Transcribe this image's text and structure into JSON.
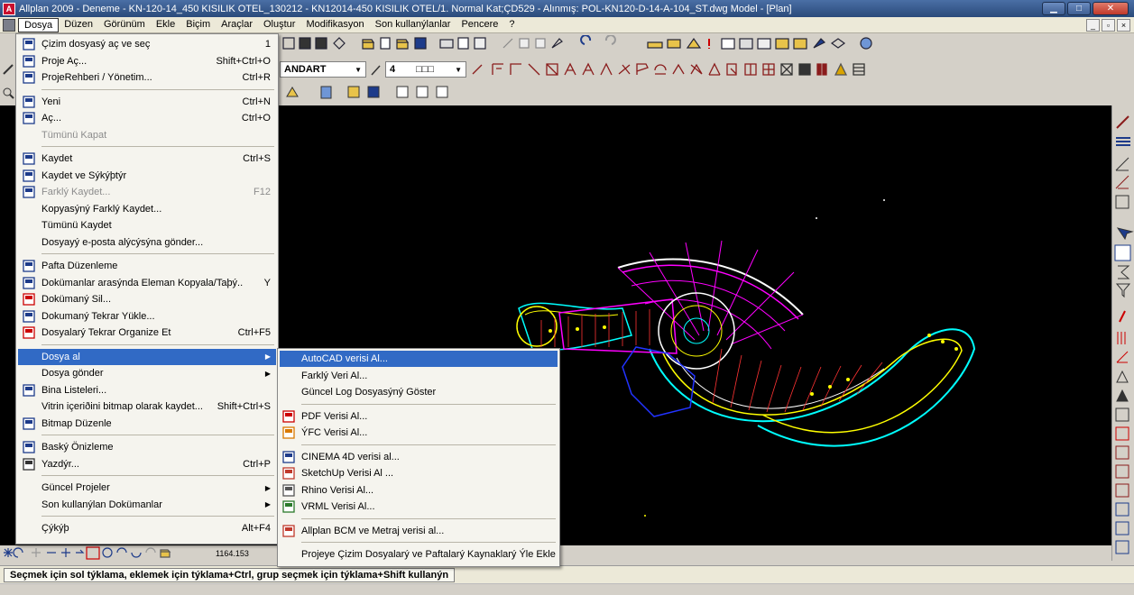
{
  "window": {
    "title": "Allplan 2009 - Deneme - KN-120-14_450 KISILIK OTEL_130212 - KN12014-450 KISILIK OTEL/1. Normal Kat;ÇD529 - Alınmış: POL-KN120-D-14-A-104_ST.dwg Model - [Plan]",
    "minimize": "▁",
    "maximize": "□",
    "close": "✕"
  },
  "menubar": {
    "items": [
      "Dosya",
      "Düzen",
      "Görünüm",
      "Ekle",
      "Biçim",
      "Araçlar",
      "Oluştur",
      "Modifikasyon",
      "Son kullanýlanlar",
      "Pencere",
      "?"
    ],
    "mdi": [
      "_",
      "▫",
      "×"
    ]
  },
  "toolbar": {
    "style_combo": "ANDART",
    "pen_combo": "4",
    "pen_pattern": "□□□"
  },
  "file_menu": [
    {
      "label": "Çizim dosyasý aç ve seç",
      "shortcut": "1",
      "icon": "open-drawing-icon"
    },
    {
      "label": "Proje Aç...",
      "shortcut": "Shift+Ctrl+O",
      "icon": "project-open-icon"
    },
    {
      "label": "ProjeRehberi / Yönetim...",
      "shortcut": "Ctrl+R",
      "icon": "project-guide-icon"
    },
    {
      "sep": true
    },
    {
      "label": "Yeni",
      "shortcut": "Ctrl+N",
      "icon": "new-file-icon"
    },
    {
      "label": "Aç...",
      "shortcut": "Ctrl+O",
      "icon": "open-folder-icon"
    },
    {
      "label": "Tümünü Kapat",
      "shortcut": "",
      "disabled": true
    },
    {
      "sep": true
    },
    {
      "label": "Kaydet",
      "shortcut": "Ctrl+S",
      "icon": "save-icon"
    },
    {
      "label": "Kaydet ve Sýkýþtýr",
      "shortcut": "",
      "icon": "save-compress-icon"
    },
    {
      "label": "Farklý Kaydet...",
      "shortcut": "F12",
      "icon": "save-as-icon",
      "disabled": true
    },
    {
      "label": "Kopyasýný Farklý Kaydet...",
      "shortcut": ""
    },
    {
      "label": "Tümünü Kaydet",
      "shortcut": ""
    },
    {
      "label": "Dosyayý e-posta alýcýsýna gönder...",
      "shortcut": ""
    },
    {
      "sep": true
    },
    {
      "label": "Pafta Düzenleme",
      "shortcut": "",
      "icon": "layout-edit-icon"
    },
    {
      "label": "Dokümanlar arasýnda  Eleman Kopyala/Taþý..",
      "shortcut": "Y",
      "icon": "copy-between-docs-icon"
    },
    {
      "label": "Dokümaný Sil...",
      "shortcut": "",
      "icon": "delete-doc-icon"
    },
    {
      "label": "Dokumaný Tekrar Yükle...",
      "shortcut": "",
      "icon": "reload-doc-icon"
    },
    {
      "label": "Dosyalarý Tekrar Organize Et",
      "shortcut": "Ctrl+F5",
      "icon": "reorganize-icon"
    },
    {
      "sep": true
    },
    {
      "label": "Dosya al",
      "shortcut": "",
      "submenu": true,
      "highlighted": true
    },
    {
      "label": "Dosya gönder",
      "shortcut": "",
      "submenu": true
    },
    {
      "label": "Bina Listeleri...",
      "shortcut": "",
      "icon": "building-list-icon"
    },
    {
      "label": "Vitrin içeriðini bitmap olarak kaydet...",
      "shortcut": "Shift+Ctrl+S"
    },
    {
      "label": "Bitmap Düzenle",
      "shortcut": "",
      "icon": "bitmap-edit-icon"
    },
    {
      "sep": true
    },
    {
      "label": "Baský Önizleme",
      "shortcut": "",
      "icon": "print-preview-icon"
    },
    {
      "label": "Yazdýr...",
      "shortcut": "Ctrl+P",
      "icon": "print-icon"
    },
    {
      "sep": true
    },
    {
      "label": "Güncel Projeler",
      "shortcut": "",
      "submenu": true
    },
    {
      "label": "Son kullanýlan Dokümanlar",
      "shortcut": "",
      "submenu": true
    },
    {
      "sep": true
    },
    {
      "label": "Çýkýþ",
      "shortcut": "Alt+F4"
    }
  ],
  "import_submenu": [
    {
      "label": "AutoCAD verisi Al...",
      "highlighted": true
    },
    {
      "label": "Farklý Veri Al..."
    },
    {
      "label": "Güncel Log Dosyasýný Göster"
    },
    {
      "sep": true
    },
    {
      "label": "PDF Verisi Al...",
      "icon": "pdf-icon"
    },
    {
      "label": "ÝFC Verisi Al...",
      "icon": "ifc-icon"
    },
    {
      "sep": true
    },
    {
      "label": "CINEMA 4D verisi al...",
      "icon": "cinema4d-icon"
    },
    {
      "label": "SketchUp Verisi Al ...",
      "icon": "sketchup-icon"
    },
    {
      "label": "Rhino Verisi Al...",
      "icon": "rhino-icon"
    },
    {
      "label": "VRML Verisi Al...",
      "icon": "vrml-icon"
    },
    {
      "sep": true
    },
    {
      "label": "Allplan BCM ve Metraj verisi al...",
      "icon": "bcm-icon"
    },
    {
      "sep": true
    },
    {
      "label": "Projeye Çizim Dosyalarý ve Paftalarý Kaynaklarý Ýle Ekle"
    }
  ],
  "bottom": {
    "coordinate": "1164.153"
  },
  "status": {
    "hint": "Seçmek için sol týklama, eklemek için týklama+Ctrl, grup seçmek için týklama+Shift kullanýn"
  },
  "colors": {
    "highlight": "#316ac5",
    "canvas": "#000000",
    "menu_bg": "#f5f4ee"
  }
}
